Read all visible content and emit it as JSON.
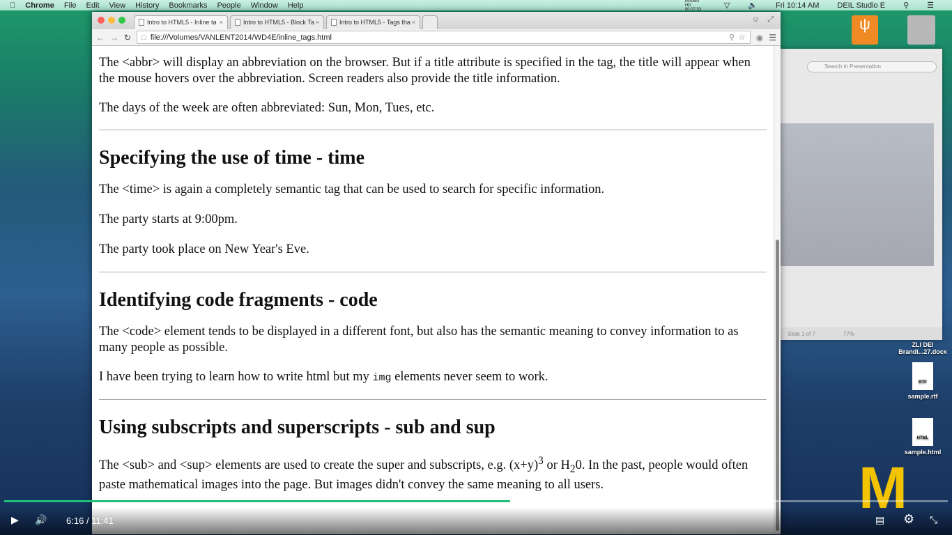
{
  "menubar": {
    "app": "Chrome",
    "items": [
      "File",
      "Edit",
      "View",
      "History",
      "Bookmarks",
      "People",
      "Window",
      "Help"
    ],
    "clock": "Fri 10:14 AM",
    "user": "DEIL Studio E",
    "recorder": "iShowU HD 00:07:53"
  },
  "browser": {
    "tabs": [
      {
        "label": "Intro to HTML5 - Inline ta"
      },
      {
        "label": "Intro to HTML5 - Block Ta"
      },
      {
        "label": "Intro to HTML5 - Tags tha"
      }
    ],
    "url": "file:///Volumes/VANLENT2014/WD4E/inline_tags.html"
  },
  "page": {
    "p1": "The <abbr> will display an abbreviation on the browser. But if a title attribute is specified in the tag, the title will appear when the mouse hovers over the abbreviation. Screen readers also provide the title information.",
    "p2": "The days of the week are often abbreviated: Sun, Mon, Tues, etc.",
    "h_time": "Specifying the use of time - time",
    "p3": "The <time> is again a completely semantic tag that can be used to search for specific information.",
    "p4": "The party starts at 9:00pm.",
    "p5": "The party took place on New Year's Eve.",
    "h_code": "Identifying code fragments - code",
    "p6": "The <code> element tends to be displayed in a different font, but also has the semantic meaning to convey information to as many people as possible.",
    "p7a": "I have been trying to learn how to write html but my ",
    "p7code": "img",
    "p7b": " elements never seem to work.",
    "h_sub": "Using subscripts and superscripts - sub and sup",
    "p8a": "The <sub> and <sup> elements are used to create the super and subscripts, e.g. (x+y)",
    "p8sup": "3",
    "p8b": " or H",
    "p8sub": "2",
    "p8c": "0. In the past, people would often paste mathematical images into the page. But images didn't convey the same meaning to all users."
  },
  "ppt": {
    "search_placeholder": "Search in Presentation",
    "slide_status": "Slide 1 of 7",
    "zoom": "77%"
  },
  "desktop": {
    "icons": [
      {
        "label": "ZLI DEI Brandi...27.docx"
      },
      {
        "label": "sample.rtf",
        "type": "RTF"
      },
      {
        "label": "sample.html",
        "type": "HTML"
      }
    ],
    "logo": "M"
  },
  "video": {
    "current": "6:16",
    "separator": "/",
    "duration": "11:41",
    "progress": 0.536
  }
}
